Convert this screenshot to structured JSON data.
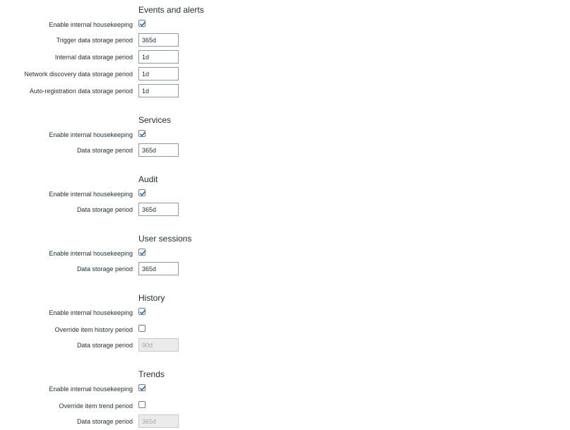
{
  "sections": [
    {
      "title": "Events and alerts",
      "rows": [
        {
          "label": "Enable internal housekeeping",
          "type": "checkbox",
          "checked": true
        },
        {
          "label": "Trigger data storage period",
          "type": "input",
          "value": "365d",
          "disabled": false
        },
        {
          "label": "Internal data storage period",
          "type": "input",
          "value": "1d",
          "disabled": false
        },
        {
          "label": "Network discovery data storage period",
          "type": "input",
          "value": "1d",
          "disabled": false
        },
        {
          "label": "Auto-registration data storage period",
          "type": "input",
          "value": "1d",
          "disabled": false
        }
      ]
    },
    {
      "title": "Services",
      "rows": [
        {
          "label": "Enable internal housekeeping",
          "type": "checkbox",
          "checked": true
        },
        {
          "label": "Data storage period",
          "type": "input",
          "value": "365d",
          "disabled": false
        }
      ]
    },
    {
      "title": "Audit",
      "rows": [
        {
          "label": "Enable internal housekeeping",
          "type": "checkbox",
          "checked": true
        },
        {
          "label": "Data storage period",
          "type": "input",
          "value": "365d",
          "disabled": false
        }
      ]
    },
    {
      "title": "User sessions",
      "rows": [
        {
          "label": "Enable internal housekeeping",
          "type": "checkbox",
          "checked": true
        },
        {
          "label": "Data storage period",
          "type": "input",
          "value": "365d",
          "disabled": false
        }
      ]
    },
    {
      "title": "History",
      "rows": [
        {
          "label": "Enable internal housekeeping",
          "type": "checkbox",
          "checked": true
        },
        {
          "label": "Override item history period",
          "type": "checkbox",
          "checked": false
        },
        {
          "label": "Data storage period",
          "type": "input",
          "value": "90d",
          "disabled": true
        }
      ]
    },
    {
      "title": "Trends",
      "rows": [
        {
          "label": "Enable internal housekeeping",
          "type": "checkbox",
          "checked": true
        },
        {
          "label": "Override item trend period",
          "type": "checkbox",
          "checked": false
        },
        {
          "label": "Data storage period",
          "type": "input",
          "value": "365d",
          "disabled": true
        }
      ]
    }
  ],
  "colors": {
    "check": "#1f6fb5",
    "text": "#1f2c33"
  }
}
